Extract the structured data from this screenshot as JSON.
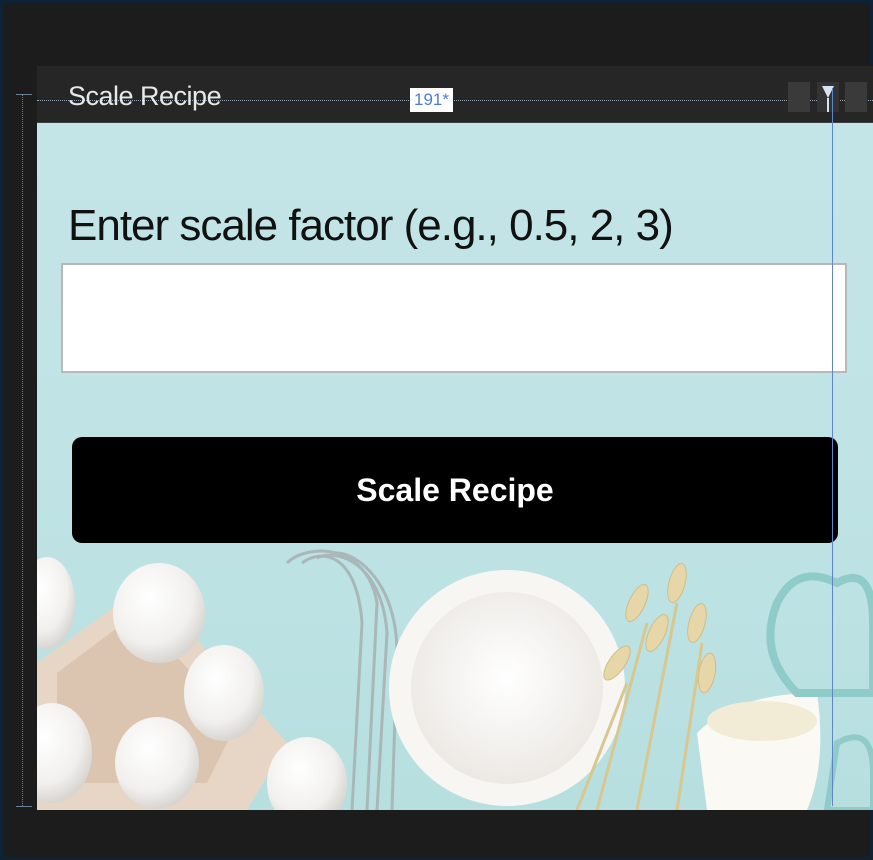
{
  "window": {
    "title": "Scale Recipe",
    "size_badge": "191*"
  },
  "form": {
    "prompt_label": "Enter scale factor (e.g., 0.5, 2, 3)",
    "input_value": "",
    "input_placeholder": "",
    "button_label": "Scale Recipe"
  },
  "colors": {
    "background_teal": "#c4e5e7",
    "button_bg": "#000000",
    "button_text": "#ffffff",
    "badge_text": "#4d7dd6"
  },
  "icons": {
    "dropdown_marker": "triangle-down-icon",
    "background_image": "baking-ingredients-image"
  }
}
